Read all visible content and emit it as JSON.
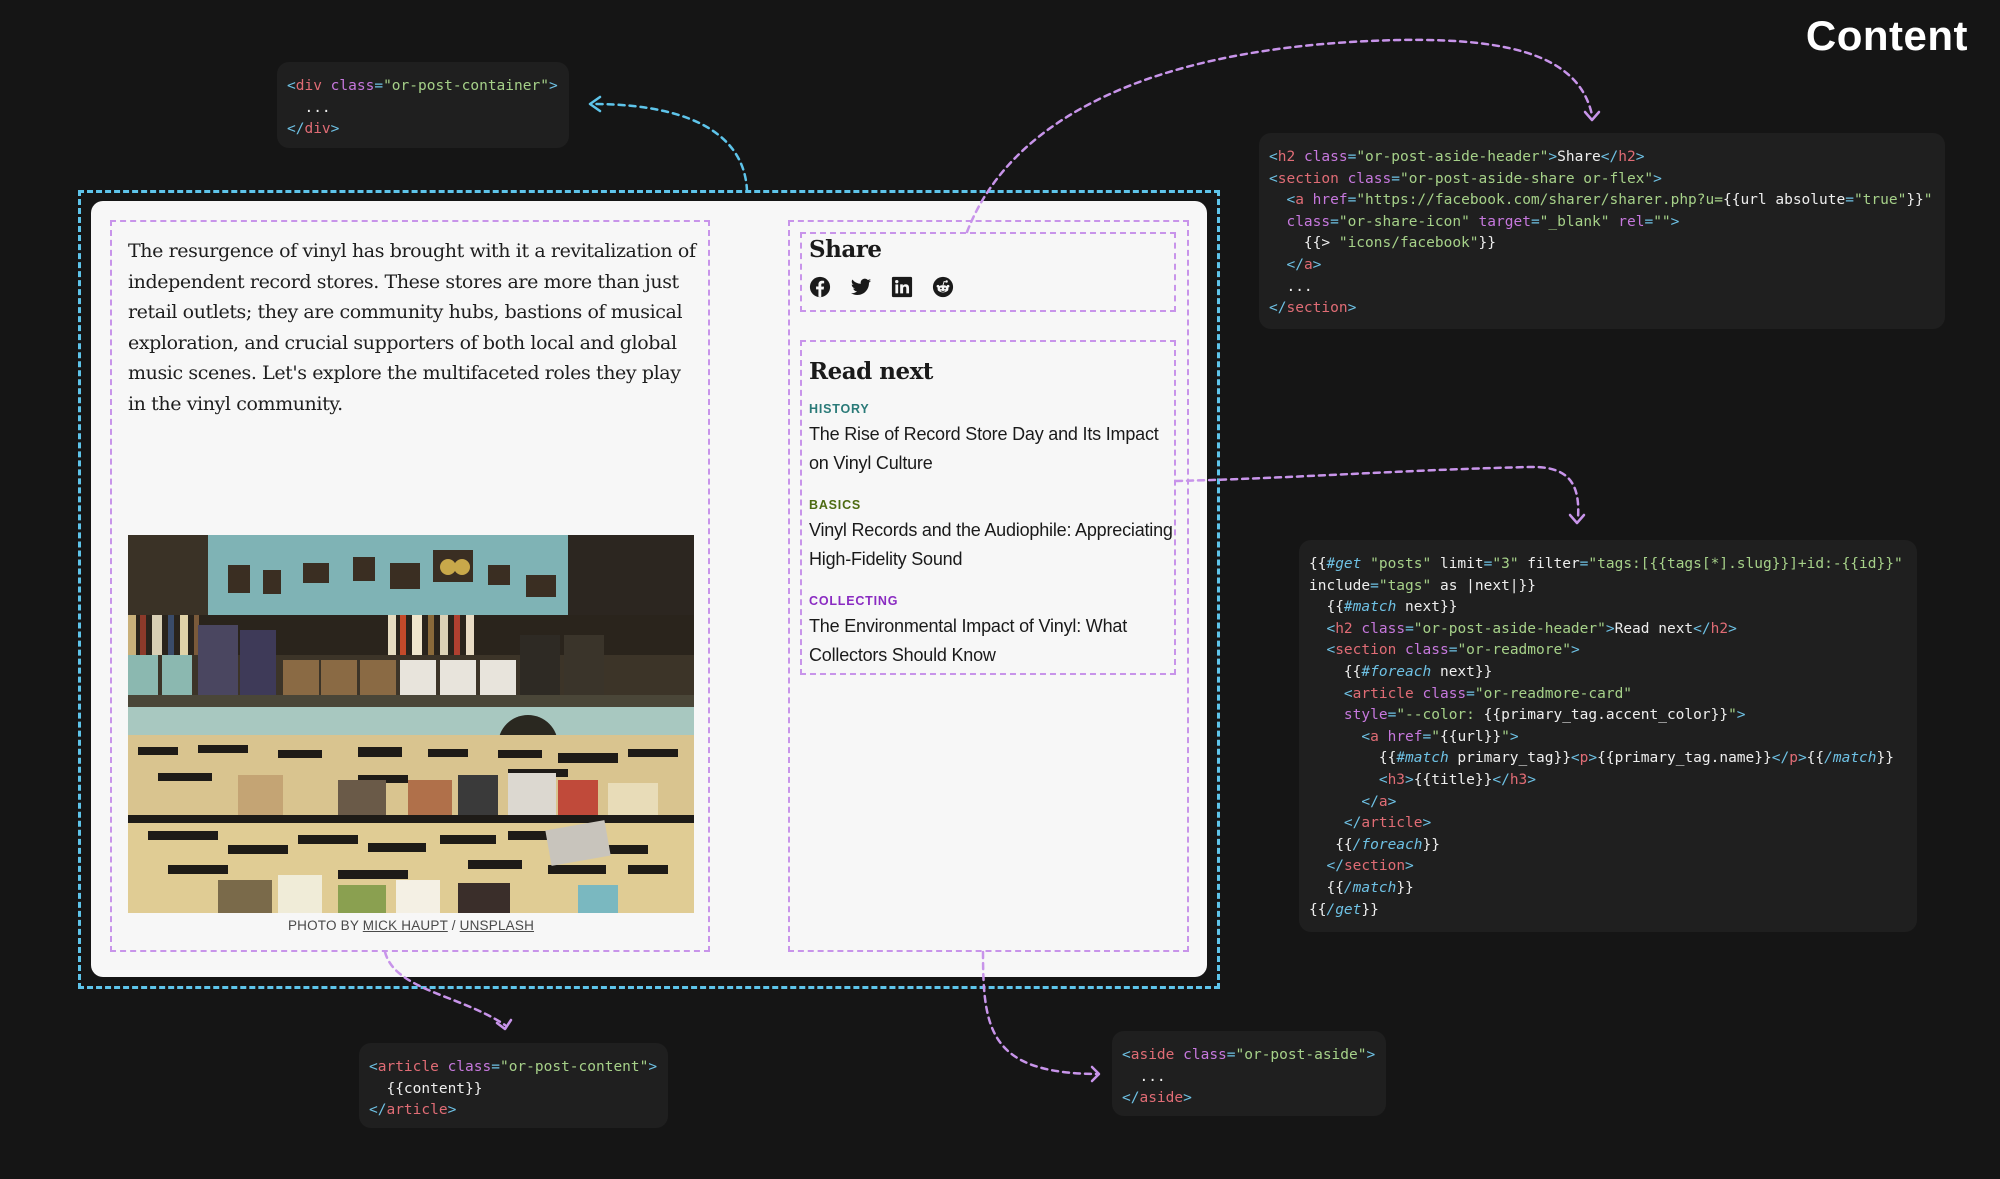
{
  "header": {
    "title": "Content"
  },
  "colors": {
    "background": "#151515",
    "code_box": "#1f1f1f",
    "container_outline": "#5ec4ea",
    "element_outline": "#c894ea",
    "card": "#f7f7f7",
    "tag_history": "#2a7a78",
    "tag_basics": "#4d6b12",
    "tag_collecting": "#8a2bc2"
  },
  "post": {
    "body": "The resurgence of vinyl has brought with it a revitalization of independent record stores. These stores are more than just retail outlets; they are community hubs, bastions of musical exploration, and crucial supporters of both local and global music scenes. Let's explore the multifaceted roles they play in the vinyl community.",
    "image_alt": "Record store shelves full of vinyl records and CDs",
    "caption": {
      "prefix": "PHOTO BY ",
      "author": "MICK HAUPT",
      "separator": " / ",
      "source": "UNSPLASH"
    }
  },
  "aside": {
    "share": {
      "heading": "Share",
      "icons": [
        {
          "name": "facebook-icon",
          "label": "Facebook"
        },
        {
          "name": "twitter-icon",
          "label": "Twitter"
        },
        {
          "name": "linkedin-icon",
          "label": "LinkedIn"
        },
        {
          "name": "reddit-icon",
          "label": "Reddit"
        }
      ]
    },
    "read_next": {
      "heading": "Read next",
      "cards": [
        {
          "tag": "HISTORY",
          "tag_color": "#2a7a78",
          "title": "The Rise of Record Store Day and Its Impact on Vinyl Culture"
        },
        {
          "tag": "BASICS",
          "tag_color": "#4d6b12",
          "title": "Vinyl Records and the Audiophile: Appreciating High-Fidelity Sound"
        },
        {
          "tag": "COLLECTING",
          "tag_color": "#8a2bc2",
          "title": "The Environmental Impact of Vinyl: What Collectors Should Know"
        }
      ]
    }
  },
  "code": {
    "container": [
      [
        [
          "p",
          "<"
        ],
        [
          "t",
          "div"
        ],
        [
          "s",
          " "
        ],
        [
          "a",
          "class"
        ],
        [
          "p",
          "="
        ],
        [
          "v",
          "\"or-post-container\""
        ],
        [
          "p",
          ">"
        ]
      ],
      [
        [
          "x",
          "  ..."
        ]
      ],
      [
        [
          "p",
          "</"
        ],
        [
          "t",
          "div"
        ],
        [
          "p",
          ">"
        ]
      ]
    ],
    "share": [
      [
        [
          "p",
          "<"
        ],
        [
          "t",
          "h2"
        ],
        [
          "s",
          " "
        ],
        [
          "a",
          "class"
        ],
        [
          "p",
          "="
        ],
        [
          "v",
          "\"or-post-aside-header\""
        ],
        [
          "p",
          ">"
        ],
        [
          "x",
          "Share"
        ],
        [
          "p",
          "</"
        ],
        [
          "t",
          "h2"
        ],
        [
          "p",
          ">"
        ]
      ],
      [
        [
          "p",
          "<"
        ],
        [
          "t",
          "section"
        ],
        [
          "s",
          " "
        ],
        [
          "a",
          "class"
        ],
        [
          "p",
          "="
        ],
        [
          "v",
          "\"or-post-aside-share or-flex\""
        ],
        [
          "p",
          ">"
        ]
      ],
      [
        [
          "s",
          "  "
        ],
        [
          "p",
          "<"
        ],
        [
          "t",
          "a"
        ],
        [
          "s",
          " "
        ],
        [
          "a",
          "href"
        ],
        [
          "p",
          "="
        ],
        [
          "v",
          "\"https://facebook.com/sharer/sharer.php?u="
        ],
        [
          "x",
          "{{url absolute"
        ],
        [
          "p",
          "="
        ],
        [
          "v",
          "\"true\""
        ],
        [
          "x",
          "}}"
        ],
        [
          "v",
          "\""
        ]
      ],
      [
        [
          "s",
          "  "
        ],
        [
          "a",
          "class"
        ],
        [
          "p",
          "="
        ],
        [
          "v",
          "\"or-share-icon\""
        ],
        [
          "s",
          " "
        ],
        [
          "a",
          "target"
        ],
        [
          "p",
          "="
        ],
        [
          "v",
          "\"_blank\""
        ],
        [
          "s",
          " "
        ],
        [
          "a",
          "rel"
        ],
        [
          "p",
          "="
        ],
        [
          "v",
          "\"\""
        ],
        [
          "p",
          ">"
        ]
      ],
      [
        [
          "x",
          "    {{> "
        ],
        [
          "v",
          "\"icons/facebook\""
        ],
        [
          "x",
          "}}"
        ]
      ],
      [
        [
          "s",
          "  "
        ],
        [
          "p",
          "</"
        ],
        [
          "t",
          "a"
        ],
        [
          "p",
          ">"
        ]
      ],
      [
        [
          "x",
          "  ..."
        ]
      ],
      [
        [
          "p",
          "</"
        ],
        [
          "t",
          "section"
        ],
        [
          "p",
          ">"
        ]
      ]
    ],
    "readnext": [
      [
        [
          "x",
          "{{"
        ],
        [
          "k",
          "#get"
        ],
        [
          "s",
          " "
        ],
        [
          "v",
          "\"posts\""
        ],
        [
          "x",
          " limit"
        ],
        [
          "p",
          "="
        ],
        [
          "v",
          "\"3\""
        ],
        [
          "x",
          " filter"
        ],
        [
          "p",
          "="
        ],
        [
          "v",
          "\"tags:[{{tags[*].slug}}]+id:-{{id}}\""
        ]
      ],
      [
        [
          "x",
          "include"
        ],
        [
          "p",
          "="
        ],
        [
          "v",
          "\"tags\""
        ],
        [
          "x",
          " as |next|}}"
        ]
      ],
      [
        [
          "x",
          "  {{"
        ],
        [
          "k",
          "#match"
        ],
        [
          "x",
          " next}}"
        ]
      ],
      [
        [
          "s",
          "  "
        ],
        [
          "p",
          "<"
        ],
        [
          "t",
          "h2"
        ],
        [
          "s",
          " "
        ],
        [
          "a",
          "class"
        ],
        [
          "p",
          "="
        ],
        [
          "v",
          "\"or-post-aside-header\""
        ],
        [
          "p",
          ">"
        ],
        [
          "x",
          "Read next"
        ],
        [
          "p",
          "</"
        ],
        [
          "t",
          "h2"
        ],
        [
          "p",
          ">"
        ]
      ],
      [
        [
          "s",
          "  "
        ],
        [
          "p",
          "<"
        ],
        [
          "t",
          "section"
        ],
        [
          "s",
          " "
        ],
        [
          "a",
          "class"
        ],
        [
          "p",
          "="
        ],
        [
          "v",
          "\"or-readmore\""
        ],
        [
          "p",
          ">"
        ]
      ],
      [
        [
          "x",
          "    {{"
        ],
        [
          "k",
          "#foreach"
        ],
        [
          "x",
          " next}}"
        ]
      ],
      [
        [
          "s",
          "    "
        ],
        [
          "p",
          "<"
        ],
        [
          "t",
          "article"
        ],
        [
          "s",
          " "
        ],
        [
          "a",
          "class"
        ],
        [
          "p",
          "="
        ],
        [
          "v",
          "\"or-readmore-card\""
        ]
      ],
      [
        [
          "s",
          "    "
        ],
        [
          "a",
          "style"
        ],
        [
          "p",
          "="
        ],
        [
          "v",
          "\"--color: "
        ],
        [
          "x",
          "{{primary_tag.accent_color}}"
        ],
        [
          "v",
          "\""
        ],
        [
          "p",
          ">"
        ]
      ],
      [
        [
          "s",
          "      "
        ],
        [
          "p",
          "<"
        ],
        [
          "t",
          "a"
        ],
        [
          "s",
          " "
        ],
        [
          "a",
          "href"
        ],
        [
          "p",
          "="
        ],
        [
          "v",
          "\""
        ],
        [
          "x",
          "{{url}}"
        ],
        [
          "v",
          "\""
        ],
        [
          "p",
          ">"
        ]
      ],
      [
        [
          "x",
          "        {{"
        ],
        [
          "k",
          "#match"
        ],
        [
          "x",
          " primary_tag}}"
        ],
        [
          "p",
          "<"
        ],
        [
          "t",
          "p"
        ],
        [
          "p",
          ">"
        ],
        [
          "x",
          "{{primary_tag.name}}"
        ],
        [
          "p",
          "</"
        ],
        [
          "t",
          "p"
        ],
        [
          "p",
          ">"
        ],
        [
          "x",
          "{{"
        ],
        [
          "k",
          "/match"
        ],
        [
          "x",
          "}}"
        ]
      ],
      [
        [
          "s",
          "        "
        ],
        [
          "p",
          "<"
        ],
        [
          "t",
          "h3"
        ],
        [
          "p",
          ">"
        ],
        [
          "x",
          "{{title}}"
        ],
        [
          "p",
          "</"
        ],
        [
          "t",
          "h3"
        ],
        [
          "p",
          ">"
        ]
      ],
      [
        [
          "s",
          "      "
        ],
        [
          "p",
          "</"
        ],
        [
          "t",
          "a"
        ],
        [
          "p",
          ">"
        ]
      ],
      [
        [
          "s",
          "    "
        ],
        [
          "p",
          "</"
        ],
        [
          "t",
          "article"
        ],
        [
          "p",
          ">"
        ]
      ],
      [
        [
          "x",
          "   {{"
        ],
        [
          "k",
          "/foreach"
        ],
        [
          "x",
          "}}"
        ]
      ],
      [
        [
          "s",
          "  "
        ],
        [
          "p",
          "</"
        ],
        [
          "t",
          "section"
        ],
        [
          "p",
          ">"
        ]
      ],
      [
        [
          "x",
          "  {{"
        ],
        [
          "k",
          "/match"
        ],
        [
          "x",
          "}}"
        ]
      ],
      [
        [
          "x",
          "{{"
        ],
        [
          "k",
          "/get"
        ],
        [
          "x",
          "}}"
        ]
      ]
    ],
    "content": [
      [
        [
          "p",
          "<"
        ],
        [
          "t",
          "article"
        ],
        [
          "s",
          " "
        ],
        [
          "a",
          "class"
        ],
        [
          "p",
          "="
        ],
        [
          "v",
          "\"or-post-content\""
        ],
        [
          "p",
          ">"
        ]
      ],
      [
        [
          "x",
          "  {{content}}"
        ]
      ],
      [
        [
          "p",
          "</"
        ],
        [
          "t",
          "article"
        ],
        [
          "p",
          ">"
        ]
      ]
    ],
    "aside": [
      [
        [
          "p",
          "<"
        ],
        [
          "t",
          "aside"
        ],
        [
          "s",
          " "
        ],
        [
          "a",
          "class"
        ],
        [
          "p",
          "="
        ],
        [
          "v",
          "\"or-post-aside\""
        ],
        [
          "p",
          ">"
        ]
      ],
      [
        [
          "x",
          "  ..."
        ]
      ],
      [
        [
          "p",
          "</"
        ],
        [
          "t",
          "aside"
        ],
        [
          "p",
          ">"
        ]
      ]
    ]
  }
}
